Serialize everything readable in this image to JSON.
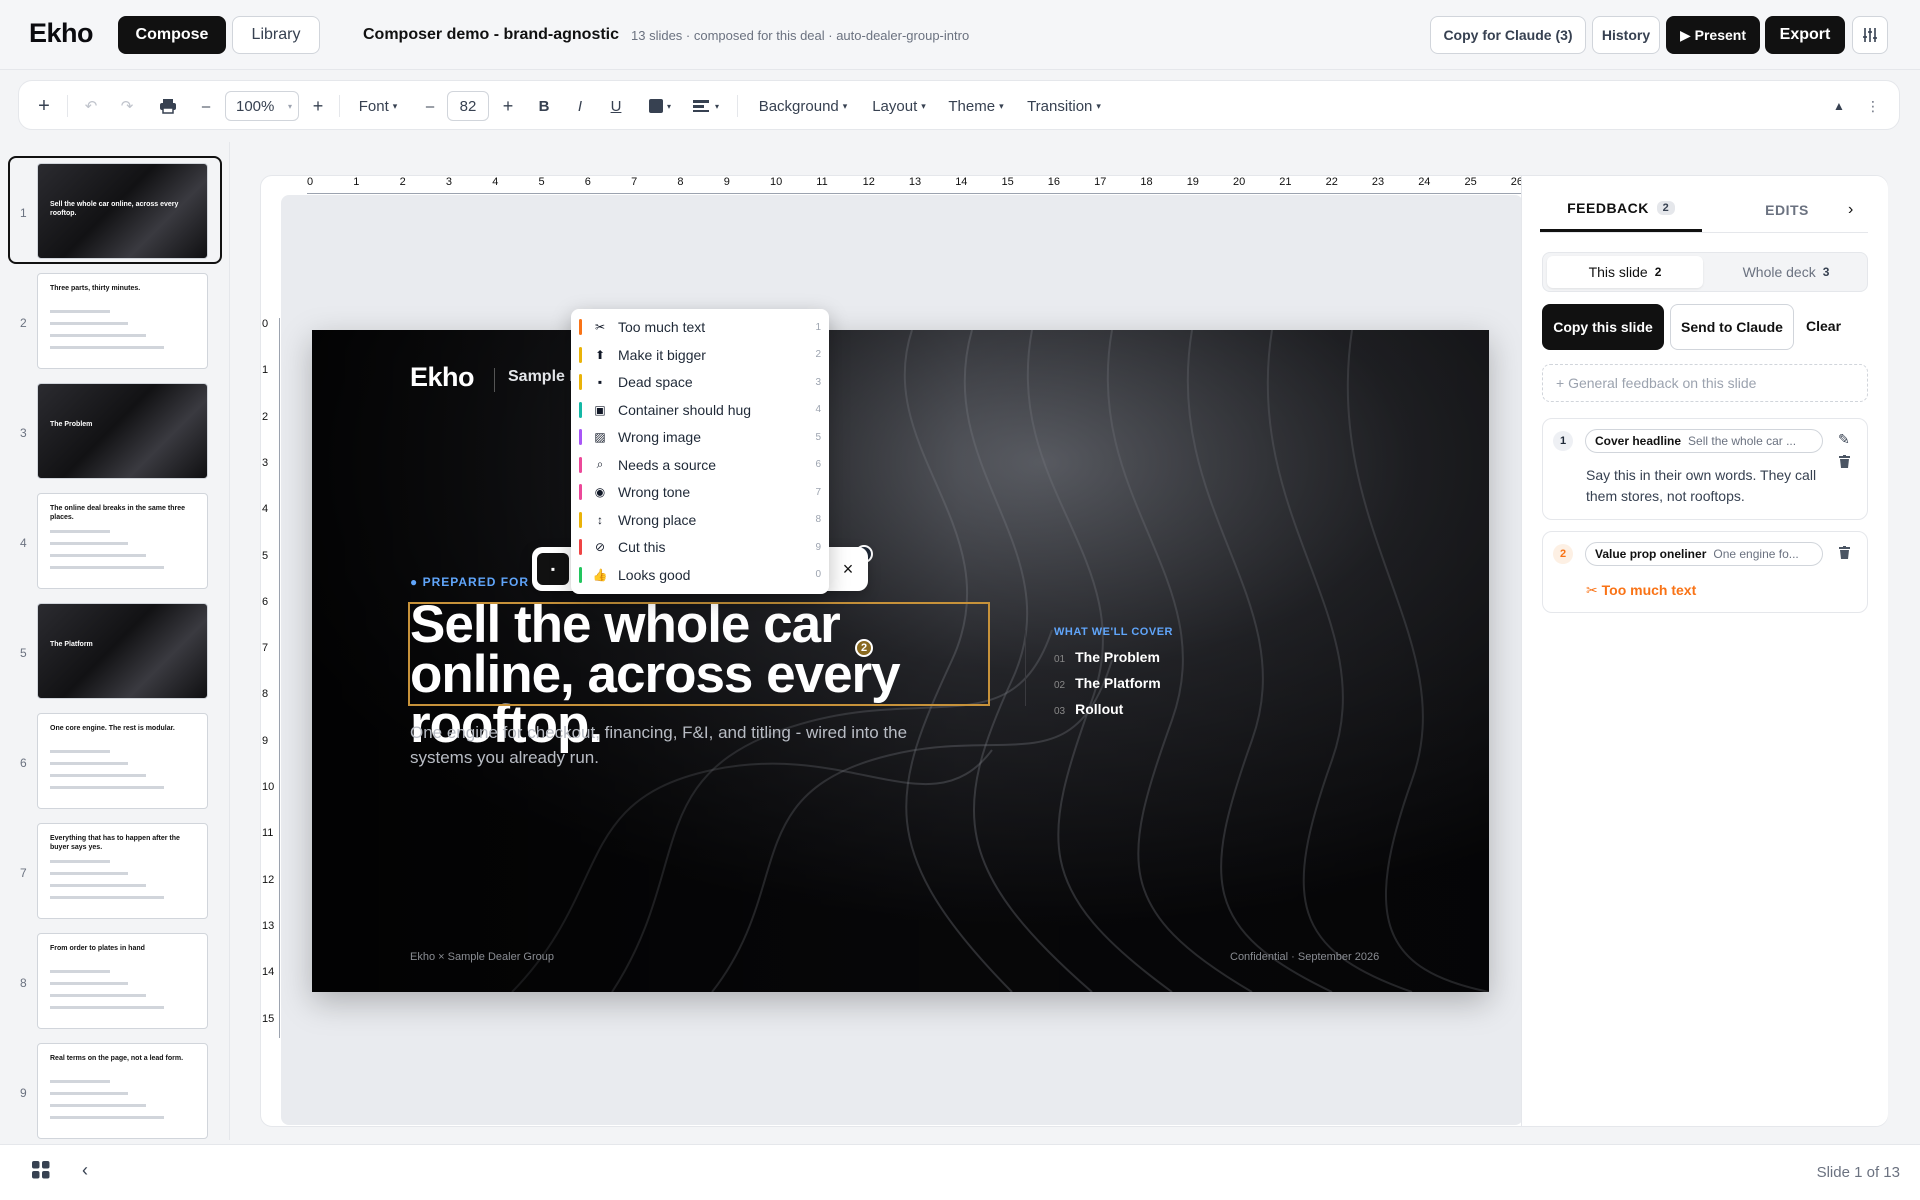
{
  "app": {
    "brand": "Ekho",
    "compose_label": "Compose",
    "library_label": "Library",
    "doc_title": "Composer demo - brand-agnostic",
    "doc_meta": "13 slides · composed for this deal · auto-dealer-group-intro",
    "copy_claude_label": "Copy for Claude (3)",
    "history_label": "History",
    "present_label": "▶ Present",
    "export_label": "Export"
  },
  "toolbar": {
    "zoom": "100%",
    "font_label": "Font",
    "font_size": "82",
    "bold": "B",
    "italic": "I",
    "underline": "U",
    "background_label": "Background",
    "layout_label": "Layout",
    "theme_label": "Theme",
    "transition_label": "Transition"
  },
  "thumbnails": [
    {
      "num": "1",
      "dark": true,
      "title": "Sell the whole car online, across every rooftop."
    },
    {
      "num": "2",
      "dark": false,
      "title": "Three parts, thirty minutes."
    },
    {
      "num": "3",
      "dark": true,
      "title": "The Problem"
    },
    {
      "num": "4",
      "dark": false,
      "title": "The online deal breaks in the same three places."
    },
    {
      "num": "5",
      "dark": true,
      "title": "The Platform"
    },
    {
      "num": "6",
      "dark": false,
      "title": "One core engine. The rest is modular."
    },
    {
      "num": "7",
      "dark": false,
      "title": "Everything that has to happen after the buyer says yes."
    },
    {
      "num": "8",
      "dark": false,
      "title": "From order to plates in hand"
    },
    {
      "num": "9",
      "dark": false,
      "title": "Real terms on the page, not a lead form."
    }
  ],
  "rulers": {
    "h": [
      "0",
      "1",
      "2",
      "3",
      "4",
      "5",
      "6",
      "7",
      "8",
      "9",
      "10",
      "11",
      "12",
      "13",
      "14",
      "15",
      "16",
      "17",
      "18",
      "19",
      "20",
      "21",
      "22",
      "23",
      "24",
      "25",
      "26"
    ],
    "v": [
      "0",
      "1",
      "2",
      "3",
      "4",
      "5",
      "6",
      "7",
      "8",
      "9",
      "10",
      "11",
      "12",
      "13",
      "14",
      "15"
    ]
  },
  "slide": {
    "logo": "Ekho",
    "client": "Sample Dealer Group",
    "prepared": "PREPARED FOR SAMPLE DEALER GROUP",
    "headline": "Sell the whole car online, across every rooftop.",
    "subhead": "One engine for checkout, financing, F&I, and titling - wired into the systems you already run.",
    "cover_label": "WHAT WE'LL COVER",
    "cover_items": [
      {
        "n": "01",
        "label": "The Problem"
      },
      {
        "n": "02",
        "label": "The Platform"
      },
      {
        "n": "03",
        "label": "Rollout"
      }
    ],
    "footer_left": "Ekho × Sample Dealer Group",
    "footer_right": "Confidential · September 2026",
    "marker1": "1",
    "marker2": "2"
  },
  "feedback_menu": [
    {
      "icon": "✂",
      "label": "Too much text",
      "key": "1",
      "color": "#f97316"
    },
    {
      "icon": "⬆",
      "label": "Make it bigger",
      "key": "2",
      "color": "#eab308"
    },
    {
      "icon": "▪",
      "label": "Dead space",
      "key": "3",
      "color": "#eab308"
    },
    {
      "icon": "▣",
      "label": "Container should hug",
      "key": "4",
      "color": "#14b8a6"
    },
    {
      "icon": "▨",
      "label": "Wrong image",
      "key": "5",
      "color": "#a855f7"
    },
    {
      "icon": "⌕",
      "label": "Needs a source",
      "key": "6",
      "color": "#ec4899"
    },
    {
      "icon": "◉",
      "label": "Wrong tone",
      "key": "7",
      "color": "#ec4899"
    },
    {
      "icon": "↕",
      "label": "Wrong place",
      "key": "8",
      "color": "#eab308"
    },
    {
      "icon": "⊘",
      "label": "Cut this",
      "key": "9",
      "color": "#ef4444"
    },
    {
      "icon": "👍",
      "label": "Looks good",
      "key": "0",
      "color": "#22c55e"
    }
  ],
  "panel": {
    "feedback_tab": "FEEDBACK",
    "feedback_count": "2",
    "edits_tab": "EDITS",
    "this_slide": "This slide",
    "this_slide_count": "2",
    "whole_deck": "Whole deck",
    "whole_deck_count": "3",
    "copy_this_slide": "Copy this slide",
    "send_to_claude": "Send to Claude",
    "clear": "Clear",
    "general_placeholder": "+ General feedback on this slide",
    "cards": [
      {
        "num": "1",
        "tag": "Cover headline",
        "preview": "Sell the whole car ...",
        "note": "Say this in their own words. They call them stores, not rooftops."
      },
      {
        "num": "2",
        "tag": "Value prop oneliner",
        "preview": "One engine fo...",
        "note": "Too much text"
      }
    ]
  },
  "footer": {
    "slide_counter": "Slide 1 of 13"
  },
  "colors": {
    "accent_dark": "#111111",
    "highlight": "#c7923a",
    "link_blue": "#60a5fa",
    "warning_orange": "#f97316"
  }
}
